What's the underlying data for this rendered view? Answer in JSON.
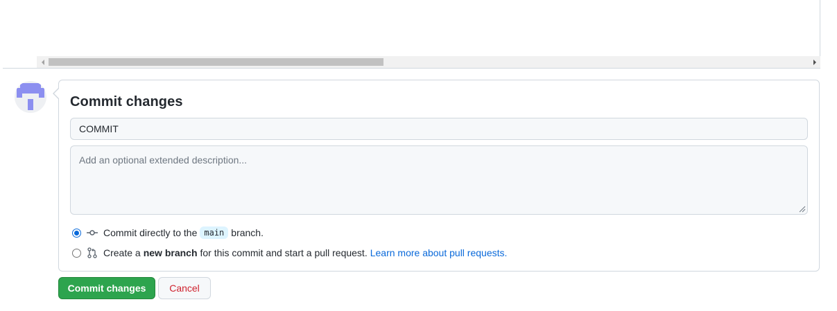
{
  "commit": {
    "title": "Commit changes",
    "summary_value": "COMMIT",
    "description_placeholder": "Add an optional extended description...",
    "option_direct": {
      "prefix": "Commit directly to the",
      "branch": "main",
      "suffix": "branch.",
      "selected": true
    },
    "option_new_branch": {
      "prefix": "Create a",
      "bold": "new branch",
      "suffix": "for this commit and start a pull request.",
      "link": "Learn more about pull requests.",
      "selected": false
    }
  },
  "buttons": {
    "commit_label": "Commit changes",
    "cancel_label": "Cancel"
  },
  "icons": {
    "avatar": "identicon-avatar",
    "commit": "git-commit-icon",
    "pull_request": "git-pull-request-icon"
  },
  "colors": {
    "primary_button": "#2da44e",
    "cancel_text": "#cf222e",
    "link": "#0969da",
    "identicon": "#8c8ff0"
  }
}
